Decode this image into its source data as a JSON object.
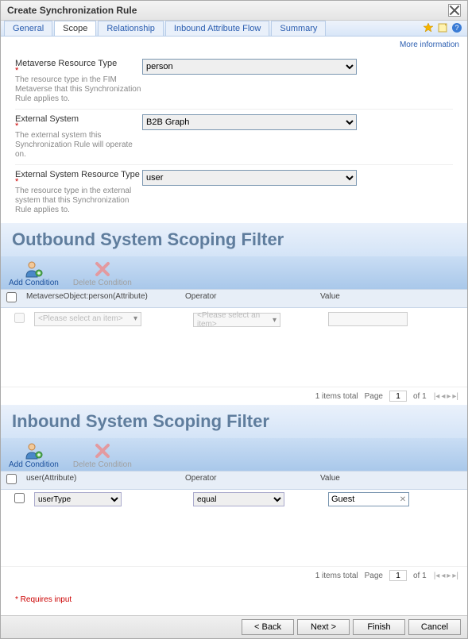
{
  "title": "Create Synchronization Rule",
  "tabs": [
    "General",
    "Scope",
    "Relationship",
    "Inbound Attribute Flow",
    "Summary"
  ],
  "active_tab": 1,
  "more_info": "More information",
  "form": {
    "metaverse_type": {
      "label": "Metaverse Resource Type",
      "desc": "The resource type in the FIM Metaverse that this Synchronization Rule applies to.",
      "value": "person"
    },
    "external_system": {
      "label": "External System",
      "desc": "The external system this Synchronization Rule will operate on.",
      "value": "B2B Graph"
    },
    "external_type": {
      "label": "External System Resource Type",
      "desc": "The resource type in the external system that this Synchronization Rule applies to.",
      "value": "user"
    }
  },
  "outbound": {
    "title": "Outbound System Scoping Filter",
    "add": "Add Condition",
    "del": "Delete Condition",
    "head_attr": "MetaverseObject:person(Attribute)",
    "head_op": "Operator",
    "head_val": "Value",
    "placeholder": "<Please select an item>",
    "items_total": "1 items total",
    "page_of": "of 1",
    "page_label": "Page",
    "page_value": "1"
  },
  "inbound": {
    "title": "Inbound System Scoping Filter",
    "add": "Add Condition",
    "del": "Delete Condition",
    "head_attr": "user(Attribute)",
    "head_op": "Operator",
    "head_val": "Value",
    "row": {
      "attr": "userType",
      "op": "equal",
      "val": "Guest"
    },
    "items_total": "1 items total",
    "page_of": "of 1",
    "page_label": "Page",
    "page_value": "1"
  },
  "req_note": "* Requires input",
  "footer": {
    "back": "< Back",
    "next": "Next >",
    "finish": "Finish",
    "cancel": "Cancel"
  }
}
